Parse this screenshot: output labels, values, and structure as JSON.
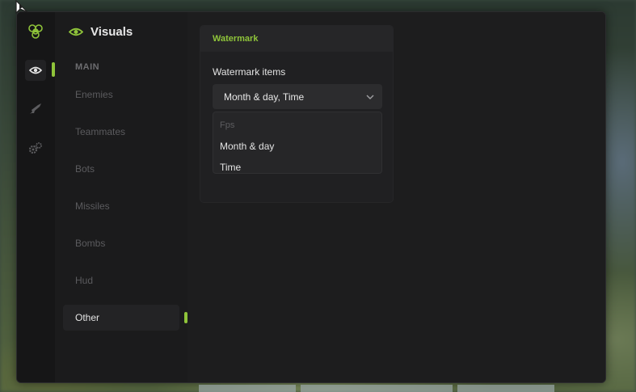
{
  "sidebar": {
    "title": "Visuals",
    "section": "MAIN",
    "items": [
      {
        "label": "Enemies"
      },
      {
        "label": "Teammates"
      },
      {
        "label": "Bots"
      },
      {
        "label": "Missiles"
      },
      {
        "label": "Bombs"
      },
      {
        "label": "Hud"
      },
      {
        "label": "Other"
      }
    ],
    "active_item": "Other"
  },
  "rail": {
    "icons": [
      "biohazard-icon",
      "eye-icon",
      "rifle-icon",
      "gears-icon"
    ],
    "active": "eye-icon"
  },
  "panel": {
    "header": "Watermark",
    "field_label": "Watermark items",
    "select_value": "Month & day, Time",
    "options": [
      {
        "label": "Fps",
        "selected": false
      },
      {
        "label": "Month & day",
        "selected": true
      },
      {
        "label": "Time",
        "selected": true
      }
    ]
  },
  "colors": {
    "accent": "#8fc43a",
    "window_bg": "#1a1a1b",
    "panel_bg": "#202022"
  }
}
